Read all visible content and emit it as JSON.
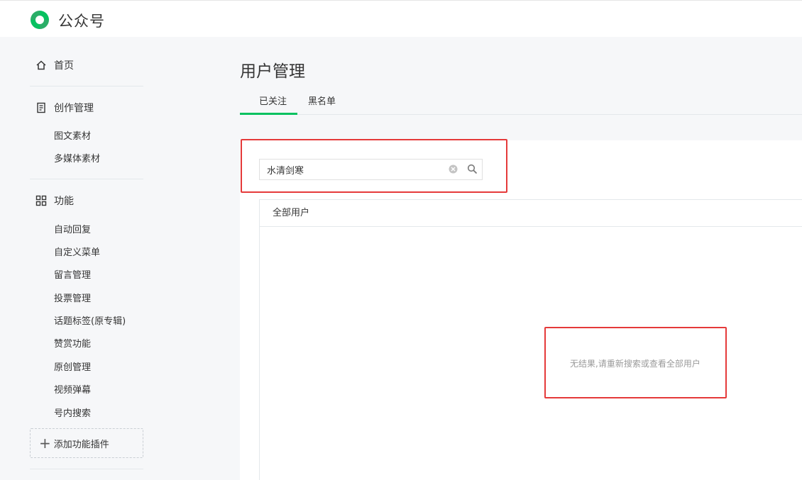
{
  "app": {
    "brand": "公众号"
  },
  "sidebar": {
    "home": {
      "label": "首页"
    },
    "creation": {
      "label": "创作管理",
      "items": [
        {
          "label": "图文素材"
        },
        {
          "label": "多媒体素材"
        }
      ]
    },
    "features": {
      "label": "功能",
      "items": [
        {
          "label": "自动回复"
        },
        {
          "label": "自定义菜单"
        },
        {
          "label": "留言管理"
        },
        {
          "label": "投票管理"
        },
        {
          "label": "话题标签(原专辑)"
        },
        {
          "label": "赞赏功能"
        },
        {
          "label": "原创管理"
        },
        {
          "label": "视频弹幕"
        },
        {
          "label": "号内搜索"
        }
      ]
    },
    "add_plugin": {
      "label": "添加功能插件"
    }
  },
  "main": {
    "title": "用户管理",
    "tabs": [
      {
        "label": "已关注",
        "active": true
      },
      {
        "label": "黑名单",
        "active": false
      }
    ],
    "search": {
      "value": "水清剑寒"
    },
    "list": {
      "header": "全部用户",
      "empty_message": "无结果,请重新搜索或查看全部用户"
    }
  },
  "colors": {
    "accent": "#07c160",
    "highlight": "#e53a3a",
    "background": "#f6f7f9"
  },
  "icons": {
    "logo": "wechat-official-account-logo",
    "home": "home-icon",
    "creation": "document-icon",
    "features": "grid-icon",
    "add": "plus-icon",
    "clear": "clear-icon",
    "search": "search-icon"
  }
}
